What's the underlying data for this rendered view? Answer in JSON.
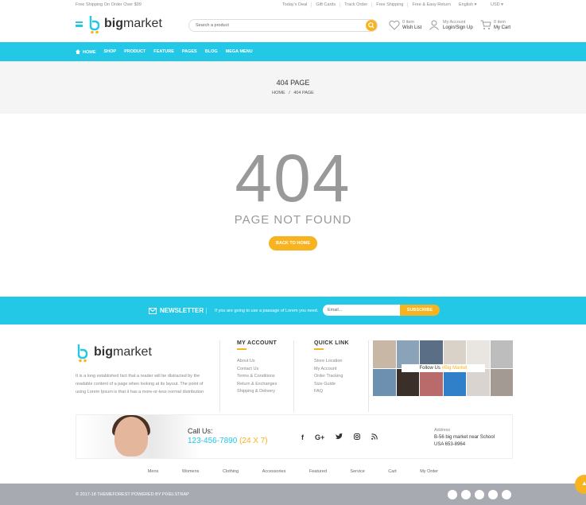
{
  "topbar": {
    "shipping": "Free Shipping On Order Over $99",
    "links": [
      "Today's Deal",
      "Gift Cards",
      "Track Order",
      "Free Shipping",
      "Free & Easy Return"
    ],
    "language": "English",
    "currency": "USD"
  },
  "header": {
    "logo_bold": "big",
    "logo_rest": "market",
    "search_placeholder": "Search a product",
    "wishlist_count": "0 item",
    "wishlist_label": "Wish List",
    "account_top": "My Account",
    "account_label": "Login/Sign Up",
    "cart_count": "0 item",
    "cart_label": "My Cart"
  },
  "nav": {
    "items": [
      "HOME",
      "SHOP",
      "PRODUCT",
      "FEATURE",
      "PAGES",
      "BLOG",
      "MEGA MENU"
    ]
  },
  "banner": {
    "title": "404 PAGE",
    "crumb_home": "HOME",
    "crumb_sep": "/",
    "crumb_current": "404 PAGE"
  },
  "error": {
    "code": "404",
    "message": "PAGE NOT FOUND",
    "button": "BACK TO HOME"
  },
  "newsletter": {
    "title": "NEWSLETTER",
    "text": "If you are going to use a passage of Lorem you need.",
    "placeholder": "Email...",
    "button": "SUBSCRIBE"
  },
  "footer": {
    "logo_bold": "big",
    "logo_rest": "market",
    "about": "It is a long established fact that a reader will be distracted by the readable content of a page when looking at its layout. The point of using Lorem Ipsum is that it has a more-or-less normal distribution",
    "my_account": {
      "title": "MY ACCOUNT",
      "items": [
        "About Us",
        "Contact Us",
        "Terms & Conditions",
        "Return & Exchanges",
        "Shipping & Delivery"
      ]
    },
    "quick_link": {
      "title": "QUICK LINK",
      "items": [
        "Store Location",
        "My Account",
        "Order Tracking",
        "Size Guide",
        "FAQ"
      ]
    },
    "instagram_label": "Follow Us",
    "instagram_tag": "#Big Market",
    "call_us": "Call Us:",
    "phone": "123-456-7890",
    "phone_hours": "(24 X 7)",
    "address_title": "Address",
    "address_line1": "B-56 big market near School",
    "address_line2": "USA 653-8964",
    "categories": [
      "Mens",
      "Womens",
      "Clothing",
      "Accessories",
      "Featured",
      "Service",
      "Cart",
      "My Order"
    ],
    "copyright": "© 2017-18 THEMEFOREST POWERED BY PIXELSTRAP"
  },
  "colors": {
    "accent": "#22c8e5",
    "secondary": "#f8b320"
  }
}
